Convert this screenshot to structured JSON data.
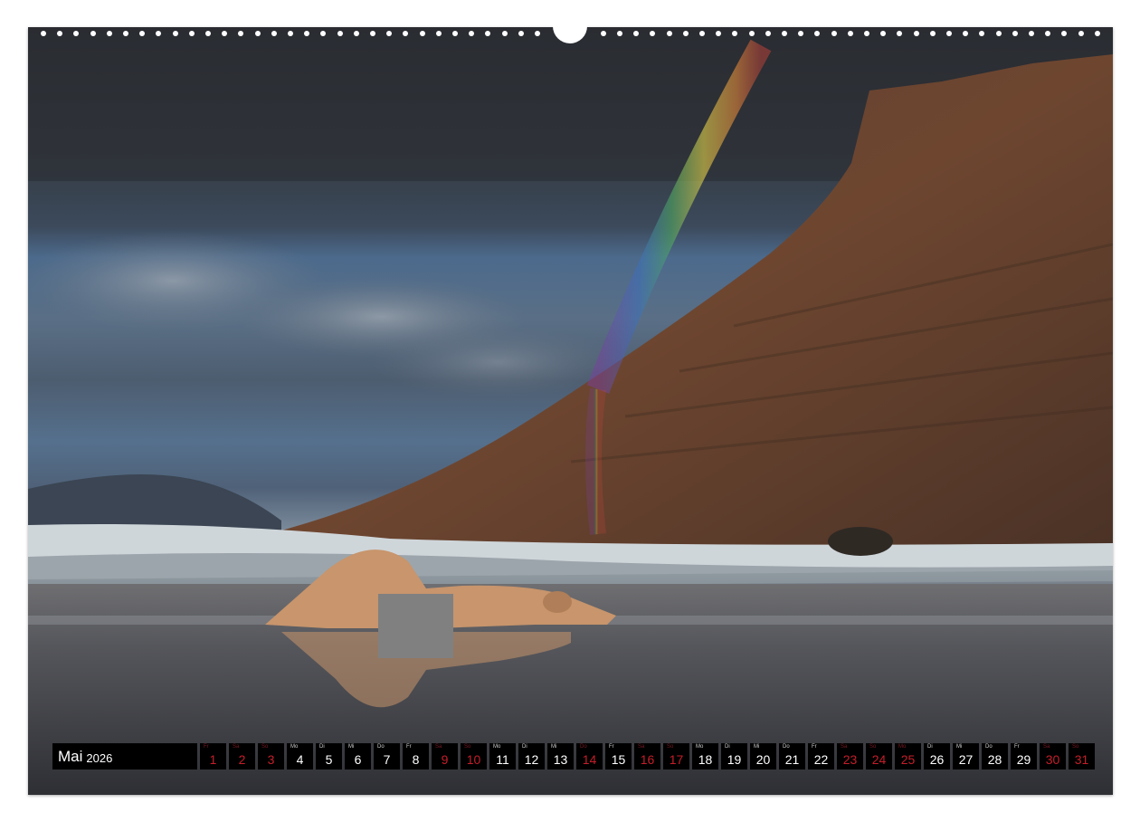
{
  "calendar": {
    "month": "Mai",
    "year": "2026",
    "days": [
      {
        "dn": "Fr",
        "d": "1",
        "red": true
      },
      {
        "dn": "Sa",
        "d": "2",
        "red": true
      },
      {
        "dn": "So",
        "d": "3",
        "red": true
      },
      {
        "dn": "Mo",
        "d": "4",
        "red": false
      },
      {
        "dn": "Di",
        "d": "5",
        "red": false
      },
      {
        "dn": "Mi",
        "d": "6",
        "red": false
      },
      {
        "dn": "Do",
        "d": "7",
        "red": false
      },
      {
        "dn": "Fr",
        "d": "8",
        "red": false
      },
      {
        "dn": "Sa",
        "d": "9",
        "red": true
      },
      {
        "dn": "So",
        "d": "10",
        "red": true
      },
      {
        "dn": "Mo",
        "d": "11",
        "red": false
      },
      {
        "dn": "Di",
        "d": "12",
        "red": false
      },
      {
        "dn": "Mi",
        "d": "13",
        "red": false
      },
      {
        "dn": "Do",
        "d": "14",
        "red": true
      },
      {
        "dn": "Fr",
        "d": "15",
        "red": false
      },
      {
        "dn": "Sa",
        "d": "16",
        "red": true
      },
      {
        "dn": "So",
        "d": "17",
        "red": true
      },
      {
        "dn": "Mo",
        "d": "18",
        "red": false
      },
      {
        "dn": "Di",
        "d": "19",
        "red": false
      },
      {
        "dn": "Mi",
        "d": "20",
        "red": false
      },
      {
        "dn": "Do",
        "d": "21",
        "red": false
      },
      {
        "dn": "Fr",
        "d": "22",
        "red": false
      },
      {
        "dn": "Sa",
        "d": "23",
        "red": true
      },
      {
        "dn": "So",
        "d": "24",
        "red": true
      },
      {
        "dn": "Mo",
        "d": "25",
        "red": true
      },
      {
        "dn": "Di",
        "d": "26",
        "red": false
      },
      {
        "dn": "Mi",
        "d": "27",
        "red": false
      },
      {
        "dn": "Do",
        "d": "28",
        "red": false
      },
      {
        "dn": "Fr",
        "d": "29",
        "red": false
      },
      {
        "dn": "Sa",
        "d": "30",
        "red": true
      },
      {
        "dn": "So",
        "d": "31",
        "red": true
      }
    ]
  },
  "colors": {
    "weekday": "#ffffff",
    "holiday": "#c41e2a",
    "cell_bg": "#000000"
  }
}
